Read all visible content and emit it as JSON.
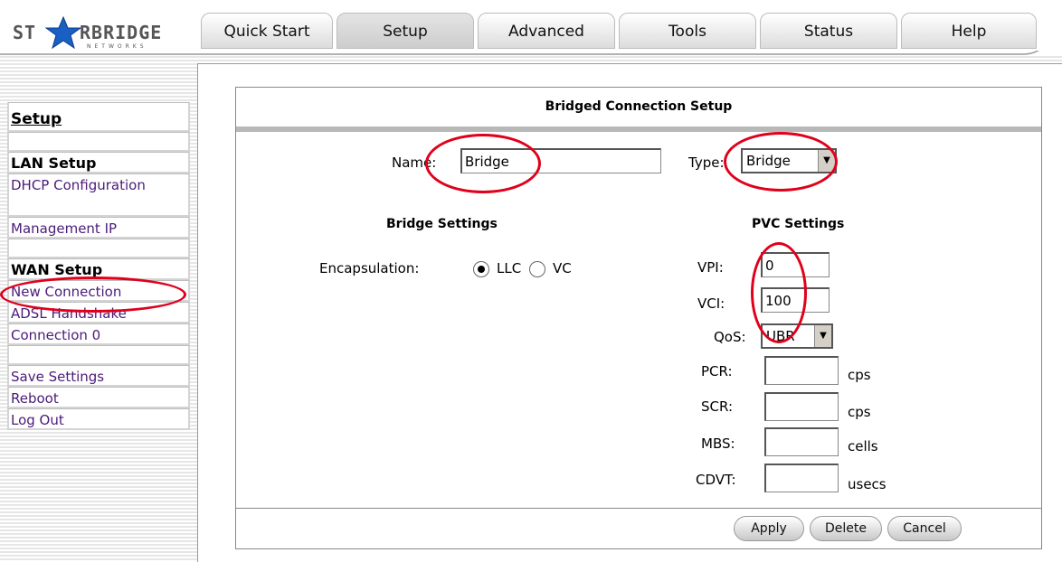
{
  "brand": {
    "logo_left": "ST",
    "logo_right": "RBRIDGE",
    "logo_sub": "NETWORKS"
  },
  "tabs": [
    {
      "label": "Quick Start"
    },
    {
      "label": "Setup"
    },
    {
      "label": "Advanced"
    },
    {
      "label": "Tools"
    },
    {
      "label": "Status"
    },
    {
      "label": "Help"
    }
  ],
  "active_tab": "Setup",
  "sidebar": {
    "title": "Setup",
    "items": [
      {
        "label": "LAN Setup"
      },
      {
        "label": "DHCP Configuration"
      },
      {
        "label": "Management IP"
      },
      {
        "label": "WAN Setup"
      },
      {
        "label": "New Connection"
      },
      {
        "label": "ADSL Handshake"
      },
      {
        "label": "Connection 0"
      },
      {
        "label": "Save Settings"
      },
      {
        "label": "Reboot"
      },
      {
        "label": "Log Out"
      }
    ]
  },
  "form": {
    "title": "Bridged Connection Setup",
    "name_label": "Name:",
    "name_value": "Bridge",
    "type_label": "Type:",
    "type_value": "Bridge",
    "bridge_settings_title": "Bridge Settings",
    "pvc_settings_title": "PVC Settings",
    "encap_label": "Encapsulation:",
    "encap_options": [
      "LLC",
      "VC"
    ],
    "encap_selected": "LLC",
    "vpi_label": "VPI:",
    "vpi_value": "0",
    "vci_label": "VCI:",
    "vci_value": "100",
    "qos_label": "QoS:",
    "qos_value": "UBR",
    "pcr_label": "PCR:",
    "pcr_unit": "cps",
    "pcr_value": "",
    "scr_label": "SCR:",
    "scr_unit": "cps",
    "scr_value": "",
    "mbs_label": "MBS:",
    "mbs_unit": "cells",
    "mbs_value": "",
    "cdvt_label": "CDVT:",
    "cdvt_unit": "usecs",
    "cdvt_value": ""
  },
  "buttons": {
    "apply": "Apply",
    "delete": "Delete",
    "cancel": "Cancel"
  },
  "colors": {
    "annotation_circle": "#e0001b",
    "sidebar_link": "#4b1b7a"
  }
}
